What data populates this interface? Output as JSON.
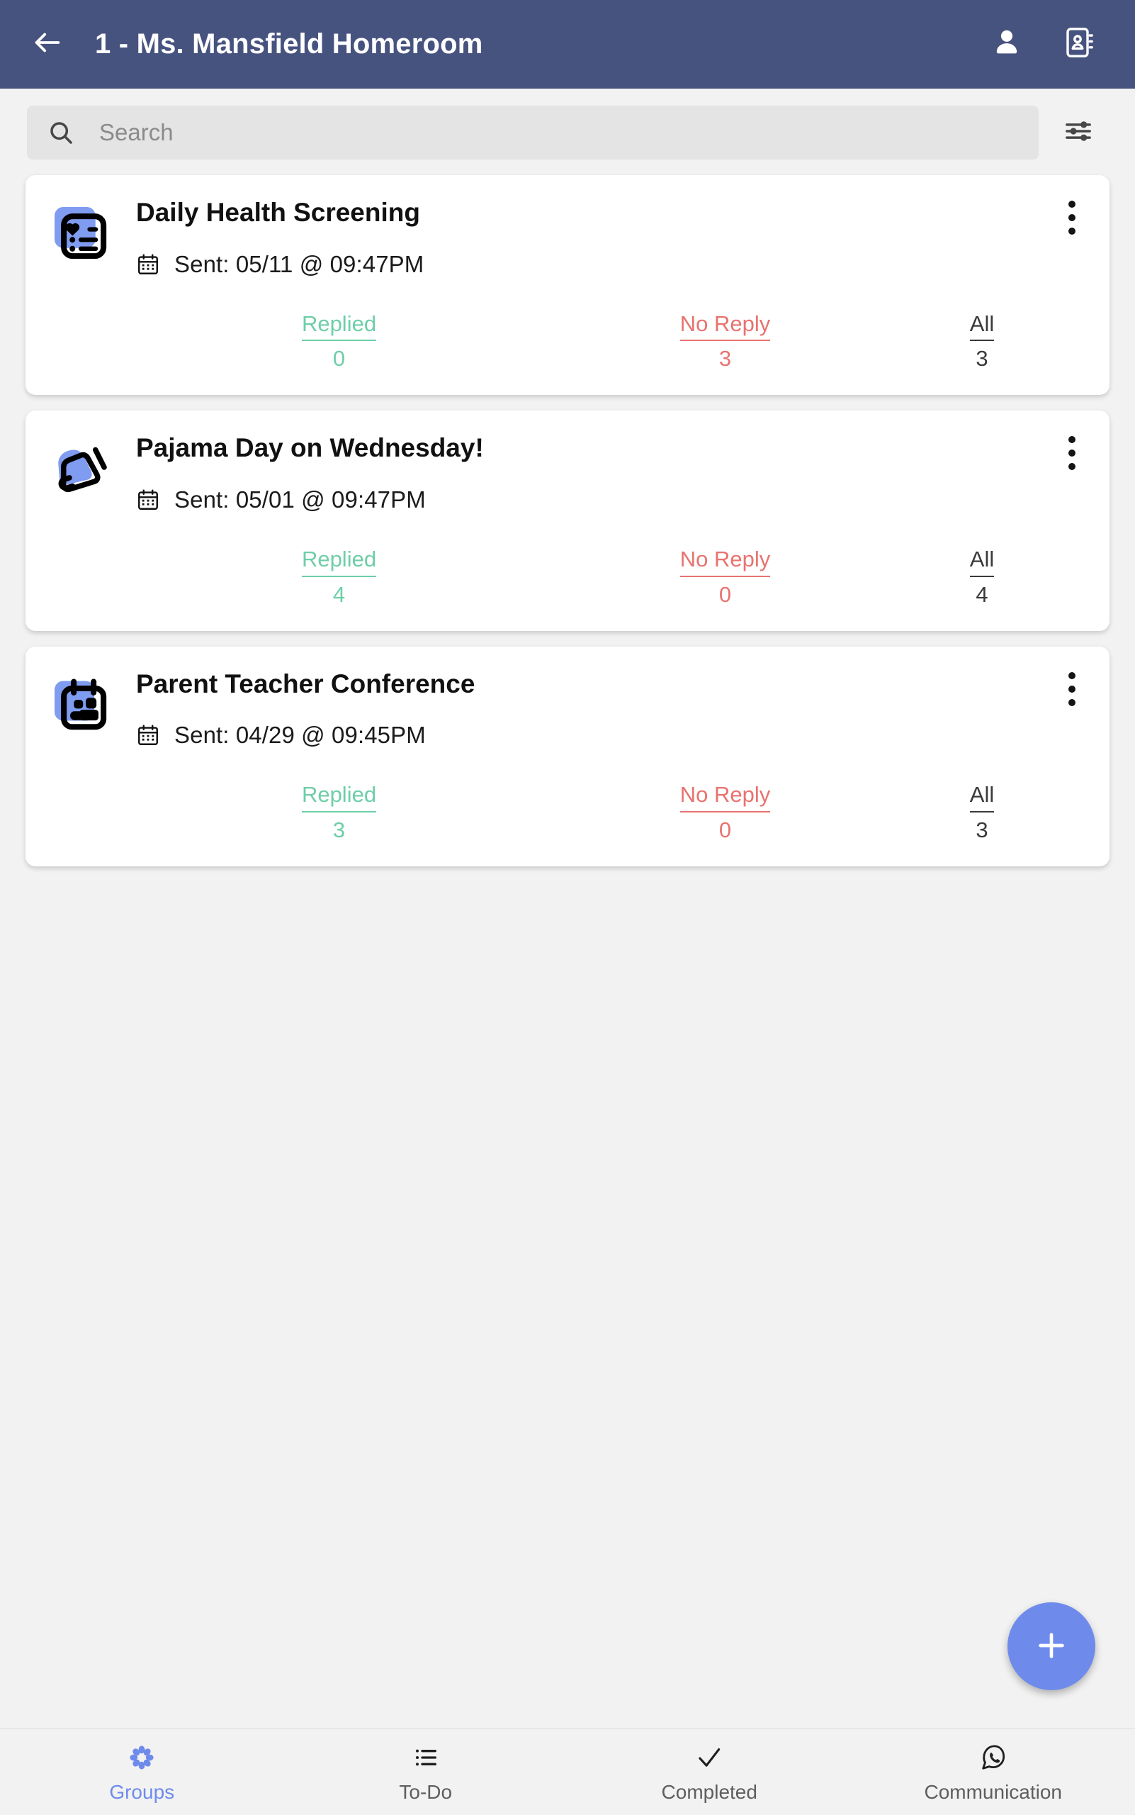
{
  "appbar": {
    "title": "1 - Ms. Mansfield Homeroom",
    "back_icon": "arrow-left-icon",
    "profile_icon": "person-icon",
    "contacts_icon": "contact-card-icon",
    "background_color": "#47537f"
  },
  "search": {
    "placeholder": "Search",
    "value": "",
    "icon": "search-icon",
    "filter_icon": "filter-sliders-icon"
  },
  "cards": [
    {
      "icon": "health-checklist-icon",
      "title": "Daily Health Screening",
      "sent_label": "Sent: 05/11 @ 09:47PM",
      "calendar_icon": "calendar-icon",
      "menu_icon": "more-vertical-icon",
      "stats": [
        {
          "label": "Replied",
          "value": "0"
        },
        {
          "label": "No Reply",
          "value": "3"
        },
        {
          "label": "All",
          "value": "3"
        }
      ]
    },
    {
      "icon": "megaphone-icon",
      "title": "Pajama Day on Wednesday!",
      "sent_label": "Sent: 05/01 @ 09:47PM",
      "calendar_icon": "calendar-icon",
      "menu_icon": "more-vertical-icon",
      "stats": [
        {
          "label": "Replied",
          "value": "4"
        },
        {
          "label": "No Reply",
          "value": "0"
        },
        {
          "label": "All",
          "value": "4"
        }
      ]
    },
    {
      "icon": "calendar-people-icon",
      "title": "Parent Teacher Conference",
      "sent_label": "Sent: 04/29 @ 09:45PM",
      "calendar_icon": "calendar-icon",
      "menu_icon": "more-vertical-icon",
      "stats": [
        {
          "label": "Replied",
          "value": "3"
        },
        {
          "label": "No Reply",
          "value": "0"
        },
        {
          "label": "All",
          "value": "3"
        }
      ]
    }
  ],
  "fab": {
    "icon": "plus-icon",
    "color": "#6e8bec"
  },
  "bottom_nav": {
    "active": "Groups",
    "items": [
      {
        "label": "Groups",
        "icon": "flower-cluster-icon"
      },
      {
        "label": "To-Do",
        "icon": "list-icon"
      },
      {
        "label": "Completed",
        "icon": "check-icon"
      },
      {
        "label": "Communication",
        "icon": "chat-bubble-icon"
      }
    ]
  },
  "colors": {
    "replied": "#6ecea8",
    "no_reply": "#e8736f",
    "all": "#3a3a3a",
    "accent": "#6e8bec",
    "header": "#47537f"
  }
}
